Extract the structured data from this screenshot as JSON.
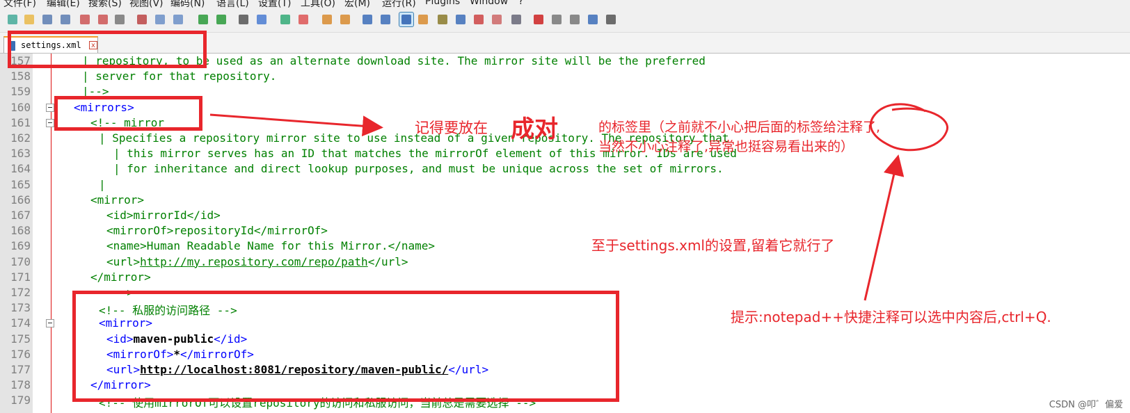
{
  "menu": [
    "文件(F)",
    "编辑(E)",
    "搜索(S)",
    "视图(V)",
    "编码(N)",
    "语言(L)",
    "设置(T)",
    "工具(O)",
    "宏(M)",
    "运行(R)",
    "Plugins",
    "Window",
    "?"
  ],
  "tab": {
    "label": "settings.xml",
    "close": "x"
  },
  "lines": [
    {
      "n": "157",
      "segs": [
        {
          "t": "| repository, to be used as an alternate download site. The mirror site will be the preferred",
          "c": "cm"
        }
      ]
    },
    {
      "n": "158",
      "segs": [
        {
          "t": "| server for that repository.",
          "c": "cm"
        }
      ]
    },
    {
      "n": "159",
      "segs": [
        {
          "t": "|-->",
          "c": "cm"
        }
      ]
    },
    {
      "n": "160",
      "segs": [
        {
          "t": "<mirrors>",
          "c": "tg"
        }
      ]
    },
    {
      "n": "161",
      "segs": [
        {
          "t": "<!-- mirror",
          "c": "cm"
        }
      ]
    },
    {
      "n": "162",
      "segs": [
        {
          "t": "| Specifies a repository mirror site to use instead of a given repository. The repository that",
          "c": "cm"
        }
      ]
    },
    {
      "n": "163",
      "segs": [
        {
          "t": "| this mirror serves has an ID that matches the mirrorOf element of this mirror. IDs are used",
          "c": "cm"
        }
      ]
    },
    {
      "n": "164",
      "segs": [
        {
          "t": "| for inheritance and direct lookup purposes, and must be unique across the set of mirrors.",
          "c": "cm"
        }
      ]
    },
    {
      "n": "165",
      "segs": [
        {
          "t": "|",
          "c": "cm"
        }
      ]
    },
    {
      "n": "166",
      "segs": [
        {
          "t": "<mirror>",
          "c": "cm"
        }
      ]
    },
    {
      "n": "167",
      "segs": [
        {
          "t": "<id>mirrorId</id>",
          "c": "cm"
        }
      ]
    },
    {
      "n": "168",
      "segs": [
        {
          "t": "<mirrorOf>repositoryId</mirrorOf>",
          "c": "cm"
        }
      ]
    },
    {
      "n": "169",
      "segs": [
        {
          "t": "<name>Human Readable Name for this Mirror.</name>",
          "c": "cm"
        }
      ]
    },
    {
      "n": "170",
      "segs": [
        {
          "t": "<url>",
          "c": "cm"
        },
        {
          "t": "http://my.repository.com/repo/path",
          "c": "cm ul"
        },
        {
          "t": "</url>",
          "c": "cm"
        }
      ]
    },
    {
      "n": "171",
      "segs": [
        {
          "t": "</mirror>",
          "c": "cm"
        }
      ]
    },
    {
      "n": "172",
      "segs": [
        {
          "t": "-->",
          "c": "cm"
        }
      ]
    },
    {
      "n": "173",
      "segs": [
        {
          "t": "<!-- 私服的访问路径 -->",
          "c": "cm"
        }
      ]
    },
    {
      "n": "174",
      "segs": [
        {
          "t": "<mirror>",
          "c": "tg"
        }
      ]
    },
    {
      "n": "175",
      "segs": [
        {
          "t": "<id>",
          "c": "tg"
        },
        {
          "t": "maven-public",
          "c": "bold"
        },
        {
          "t": "</id>",
          "c": "tg"
        }
      ]
    },
    {
      "n": "176",
      "segs": [
        {
          "t": "<mirrorOf>",
          "c": "tg"
        },
        {
          "t": "*",
          "c": "bold"
        },
        {
          "t": "</mirrorOf>",
          "c": "tg"
        }
      ]
    },
    {
      "n": "177",
      "segs": [
        {
          "t": "<url>",
          "c": "tg"
        },
        {
          "t": "http://localhost:8081/repository/maven-public/",
          "c": "bold ul"
        },
        {
          "t": "</url>",
          "c": "tg"
        }
      ]
    },
    {
      "n": "178",
      "segs": [
        {
          "t": "</mirror>",
          "c": "tg"
        }
      ]
    },
    {
      "n": "179",
      "segs": [
        {
          "t": "<!-- 使用mirrorOf可以设置repository的访问和私服访问，当前总是需要选择 -->",
          "c": "cm"
        }
      ]
    }
  ],
  "annotations": {
    "pair_note_a": "记得要放在",
    "pair_note_big": "成对",
    "pair_note_b1": "的标签里（之前就不小心把后面的标签给注释了,",
    "pair_note_b2": "当然不小心注释了,异常也挺容易看出来的）",
    "settings_note": "至于settings.xml的设置,留着它就行了",
    "shortcut_note": "提示:notepad++快捷注释可以选中内容后,ctrl+Q."
  },
  "watermark": "CSDN @叩゛偏爱",
  "colors": {
    "annotation": "#e8262c",
    "comment": "#008000",
    "tag": "#0000ff"
  }
}
